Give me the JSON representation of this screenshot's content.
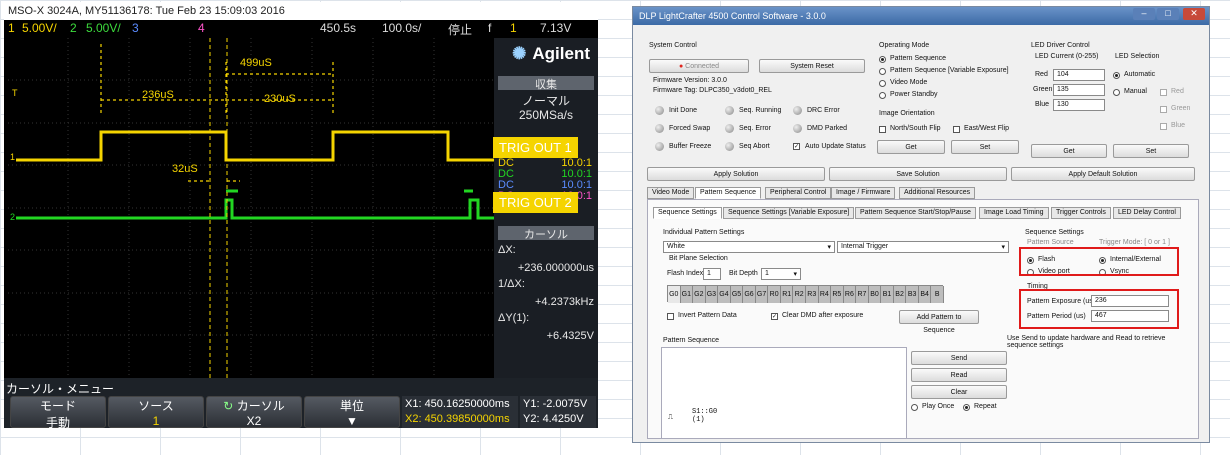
{
  "scope": {
    "header": "MSO-X 3024A, MY51136178: Tue Feb 23 15:09:03 2016",
    "ch1": "1",
    "ch1_scale": "5.00V/",
    "ch2": "2",
    "ch2_scale": "5.00V/",
    "ch3": "3",
    "ch4": "4",
    "time_delay": "450.5&#8203;s",
    "time_scale": "100.0&#8203;s/",
    "run_state": "停止",
    "trig_slope": "f",
    "trig_src": "1",
    "trig_level": "7.13V",
    "brand": "Agilent",
    "acq_title": "収集",
    "acq_mode": "ノーマル",
    "acq_rate": "250MSa/s",
    "cursor_title": "カーソル",
    "dx_label": "ΔX:",
    "dx_value": "+236.000000us",
    "inv_dx_label": "1/ΔX:",
    "inv_dx_value": "+4.2373kHz",
    "dy_label": "ΔY(1):",
    "dy_value": "+6.4325V",
    "menu_title": "カーソル・メニュー",
    "softkeys": [
      {
        "label": "モード",
        "value": "手動"
      },
      {
        "label": "ソース",
        "value": "1"
      },
      {
        "label": "カーソル",
        "value": "X2"
      },
      {
        "label": "単位",
        "value": ""
      }
    ],
    "x1": "X1: 450.16250000ms",
    "x2": "X2: 450.39850000ms",
    "y1": "Y1: -2.0075V",
    "y2": "Y2: 4.4250V",
    "ch_info": [
      {
        "coupling": "DC",
        "value": "10.0:1"
      },
      {
        "coupling": "DC",
        "value": "10.0:1"
      },
      {
        "coupling": "DC",
        "value": "10.0:1"
      },
      {
        "coupling": "DC",
        "value": "10.0:1"
      }
    ],
    "meas": {
      "m1": "499uS",
      "m2": "236uS",
      "m3": "230uS",
      "m4": "32uS"
    },
    "trig_out1": "TRIG OUT 1",
    "trig_out2": "TRIG OUT 2"
  },
  "app": {
    "title": "DLP LightCrafter 4500 Control Software - 3.0.0",
    "system_control": "System Control",
    "connected": "Connected",
    "system_reset": "System Reset",
    "fw_version": "Firmware Version: 3.0.0",
    "fw_tag": "Firmware Tag: DLPC350_v3dot0_REL",
    "status": [
      {
        "label": "Init Done"
      },
      {
        "label": "Seq. Running"
      },
      {
        "label": "DRC Error"
      },
      {
        "label": "Forced Swap"
      },
      {
        "label": "Seq. Error"
      },
      {
        "label": "DMD Parked"
      },
      {
        "label": "Buffer Freeze"
      },
      {
        "label": "Seq Abort"
      },
      {
        "label": "Auto Update Status"
      }
    ],
    "op_mode_title": "Operating Mode",
    "op_modes": [
      "Pattern Sequence",
      "Pattern Sequence [Variable Exposure]",
      "Video Mode",
      "Power Standby"
    ],
    "img_orient": "Image Orientation",
    "north_south": "North/South Flip",
    "east_west": "East/West Flip",
    "get": "Get",
    "set": "Set",
    "led_driver": "LED Driver Control",
    "led_current": "LED Current (0-255)",
    "red": "Red",
    "red_val": "104",
    "green": "Green",
    "green_val": "135",
    "blue": "Blue",
    "blue_val": "130",
    "led_selection": "LED Selection",
    "automatic": "Automatic",
    "manual": "Manual",
    "led_red": "Red",
    "led_green": "Green",
    "led_blue": "Blue",
    "apply_solution": "Apply Solution",
    "save_solution": "Save Solution",
    "apply_default": "Apply Default Solution",
    "main_tabs": [
      "Video Mode",
      "Pattern Sequence",
      "Peripheral Control",
      "Image / Firmware",
      "Additional Resources"
    ],
    "sub_tabs": [
      "Sequence Settings",
      "Sequence Settings [Variable Exposure]",
      "Pattern Sequence Start/Stop/Pause",
      "Image Load Timing",
      "Trigger Controls",
      "LED Delay Control"
    ],
    "indiv_settings": "Individual Pattern Settings",
    "color_sel": "White",
    "trigger_sel": "Internal Trigger",
    "bit_plane": "Bit Plane Selection",
    "flash_index": "Flash Index",
    "flash_val": "1",
    "bit_depth": "Bit Depth",
    "bit_depth_val": "1",
    "bits": [
      "G0",
      "G1",
      "G2",
      "G3",
      "G4",
      "G5",
      "G6",
      "G7",
      "R0",
      "R1",
      "R2",
      "R3",
      "R4",
      "R5",
      "R6",
      "R7",
      "B0",
      "B1",
      "B2",
      "B3",
      "B4",
      "B"
    ],
    "invert": "Invert Pattern Data",
    "clear_dmd": "Clear DMD after exposure",
    "add_pattern": "Add Pattern to Sequence",
    "seq_settings": "Sequence Settings",
    "pattern_source": "Pattern Source",
    "trigger_mode": "Trigger Mode: [ 0 or 1 ]",
    "flash": "Flash",
    "video_port": "Video port",
    "internal_external": "Internal/External",
    "vsync": "Vsync",
    "timing": "Timing",
    "exposure_label": "Pattern Exposure (us)",
    "exposure_val": "236",
    "period_label": "Pattern Period (us)",
    "period_val": "467",
    "note": "Use Send to update hardware and Read to retrieve sequence settings",
    "pattern_sequence": "Pattern Sequence",
    "send": "Send",
    "read": "Read",
    "clear": "Clear",
    "play_once": "Play Once",
    "repeat": "Repeat",
    "seq_item_line1": "S1::G0",
    "seq_item_line2": "(1)"
  }
}
